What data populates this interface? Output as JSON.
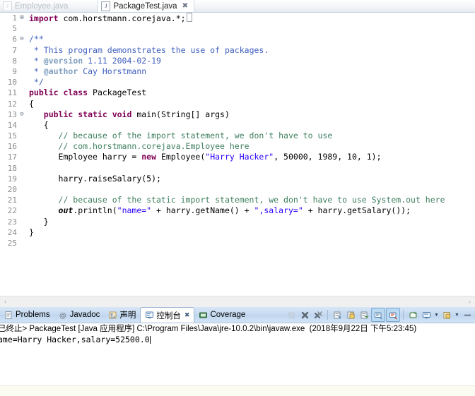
{
  "editor": {
    "tabs": [
      {
        "label": "Employee.java",
        "icon": "java-file-icon",
        "active": false,
        "closable": false
      },
      {
        "label": "PackageTest.java",
        "icon": "java-file-icon",
        "active": true,
        "closable": true
      }
    ],
    "close_glyph": "✖",
    "lines": [
      {
        "num": "1",
        "fold": "⊞",
        "segments": [
          {
            "t": "import ",
            "c": "kw"
          },
          {
            "t": "com.horstmann.corejava.*;",
            "c": "plain"
          },
          {
            "t": "CARET",
            "c": "caret"
          }
        ]
      },
      {
        "num": "5",
        "fold": "",
        "segments": []
      },
      {
        "num": "6",
        "fold": "⊖",
        "segments": [
          {
            "t": "/**",
            "c": "jdoc"
          }
        ]
      },
      {
        "num": "7",
        "fold": "",
        "segments": [
          {
            "t": " * ",
            "c": "jdoc"
          },
          {
            "t": "This program demonstrates the use of packages.",
            "c": "jdoc"
          }
        ]
      },
      {
        "num": "8",
        "fold": "",
        "segments": [
          {
            "t": " * ",
            "c": "jdoc"
          },
          {
            "t": "@version",
            "c": "jtag"
          },
          {
            "t": " 1.11 2004-02-19",
            "c": "jdoc"
          }
        ]
      },
      {
        "num": "9",
        "fold": "",
        "segments": [
          {
            "t": " * ",
            "c": "jdoc"
          },
          {
            "t": "@author",
            "c": "jtag"
          },
          {
            "t": " Cay Horstmann",
            "c": "jdoc"
          }
        ]
      },
      {
        "num": "10",
        "fold": "",
        "segments": [
          {
            "t": " */",
            "c": "jdoc"
          }
        ]
      },
      {
        "num": "11",
        "fold": "",
        "segments": [
          {
            "t": "public class ",
            "c": "kw"
          },
          {
            "t": "PackageTest",
            "c": "plain"
          }
        ]
      },
      {
        "num": "12",
        "fold": "",
        "segments": [
          {
            "t": "{",
            "c": "plain"
          }
        ]
      },
      {
        "num": "13",
        "fold": "⊖",
        "segments": [
          {
            "t": "   ",
            "c": "plain"
          },
          {
            "t": "public static void ",
            "c": "kw"
          },
          {
            "t": "main(String[] args)",
            "c": "plain"
          }
        ]
      },
      {
        "num": "14",
        "fold": "",
        "segments": [
          {
            "t": "   {",
            "c": "plain"
          }
        ]
      },
      {
        "num": "15",
        "fold": "",
        "segments": [
          {
            "t": "      // because of the import statement, we don't have to use",
            "c": "cmt"
          }
        ]
      },
      {
        "num": "16",
        "fold": "",
        "segments": [
          {
            "t": "      // com.horstmann.corejava.Employee here",
            "c": "cmt"
          }
        ]
      },
      {
        "num": "17",
        "fold": "",
        "segments": [
          {
            "t": "      Employee harry = ",
            "c": "plain"
          },
          {
            "t": "new ",
            "c": "kw"
          },
          {
            "t": "Employee(",
            "c": "plain"
          },
          {
            "t": "\"Harry Hacker\"",
            "c": "str"
          },
          {
            "t": ", 50000, 1989, 10, 1);",
            "c": "plain"
          }
        ]
      },
      {
        "num": "18",
        "fold": "",
        "segments": []
      },
      {
        "num": "19",
        "fold": "",
        "segments": [
          {
            "t": "      harry.raiseSalary(5);",
            "c": "plain"
          }
        ]
      },
      {
        "num": "20",
        "fold": "",
        "segments": []
      },
      {
        "num": "21",
        "fold": "",
        "segments": [
          {
            "t": "      // because of the static import statement, we don't have to use System.out here",
            "c": "cmt"
          }
        ]
      },
      {
        "num": "22",
        "fold": "",
        "segments": [
          {
            "t": "      ",
            "c": "plain"
          },
          {
            "t": "out",
            "c": "stat"
          },
          {
            "t": ".println(",
            "c": "plain"
          },
          {
            "t": "\"name=\"",
            "c": "str"
          },
          {
            "t": " + harry.getName() + ",
            "c": "plain"
          },
          {
            "t": "\",salary=\"",
            "c": "str"
          },
          {
            "t": " + harry.getSalary());",
            "c": "plain"
          }
        ]
      },
      {
        "num": "23",
        "fold": "",
        "segments": [
          {
            "t": "   }",
            "c": "plain"
          }
        ]
      },
      {
        "num": "24",
        "fold": "",
        "segments": [
          {
            "t": "}",
            "c": "plain"
          }
        ]
      },
      {
        "num": "25",
        "fold": "",
        "segments": []
      }
    ],
    "scroll_left_arrow": "‹",
    "scroll_right_arrow": "›"
  },
  "console_panel": {
    "tabs": [
      {
        "label": "Problems",
        "icon": "problems-icon",
        "active": false,
        "closable": false
      },
      {
        "label": "Javadoc",
        "icon": "javadoc-icon",
        "active": false,
        "closable": false
      },
      {
        "label": "声明",
        "icon": "declaration-icon",
        "active": false,
        "closable": false
      },
      {
        "label": "控制台",
        "icon": "console-icon",
        "active": true,
        "closable": true
      },
      {
        "label": "Coverage",
        "icon": "coverage-icon",
        "active": false,
        "closable": false
      }
    ],
    "close_glyph": "✖",
    "toolbar": [
      {
        "name": "terminate-button",
        "glyph": "■",
        "selected": false,
        "disabled": true,
        "caret": false
      },
      {
        "name": "remove-launch-button",
        "glyph": "✖",
        "selected": false,
        "disabled": false,
        "caret": false
      },
      {
        "name": "remove-all-terminated-button",
        "glyph": "✖",
        "selected": false,
        "disabled": false,
        "caret": false
      },
      {
        "name": "separator-1",
        "glyph": "",
        "selected": false,
        "disabled": false,
        "caret": false
      },
      {
        "name": "clear-console-button",
        "glyph": "≡",
        "selected": false,
        "disabled": false,
        "caret": false
      },
      {
        "name": "scroll-lock-button",
        "glyph": "▤",
        "selected": false,
        "disabled": false,
        "caret": false
      },
      {
        "name": "word-wrap-button",
        "glyph": "≣",
        "selected": false,
        "disabled": false,
        "caret": false
      },
      {
        "name": "show-console-stdout-button",
        "glyph": "▭",
        "selected": true,
        "disabled": false,
        "caret": false
      },
      {
        "name": "show-console-stderr-button",
        "glyph": "▭",
        "selected": true,
        "disabled": false,
        "caret": false
      },
      {
        "name": "separator-2",
        "glyph": "",
        "selected": false,
        "disabled": false,
        "caret": false
      },
      {
        "name": "pin-console-button",
        "glyph": "□",
        "selected": false,
        "disabled": false,
        "caret": false
      },
      {
        "name": "display-selected-console-button",
        "glyph": "▭",
        "selected": false,
        "disabled": false,
        "caret": true
      },
      {
        "name": "open-console-button",
        "glyph": "▤",
        "selected": false,
        "disabled": false,
        "caret": true
      },
      {
        "name": "minimize-button",
        "glyph": "—",
        "selected": false,
        "disabled": false,
        "caret": false
      }
    ],
    "output": {
      "header": "已终止> PackageTest [Java 应用程序] C:\\Program Files\\Java\\jre-10.0.2\\bin\\javaw.exe  (2018年9月22日 下午5:23:45)",
      "lines": [
        "ame=Harry Hacker,salary=52500.0"
      ]
    }
  }
}
